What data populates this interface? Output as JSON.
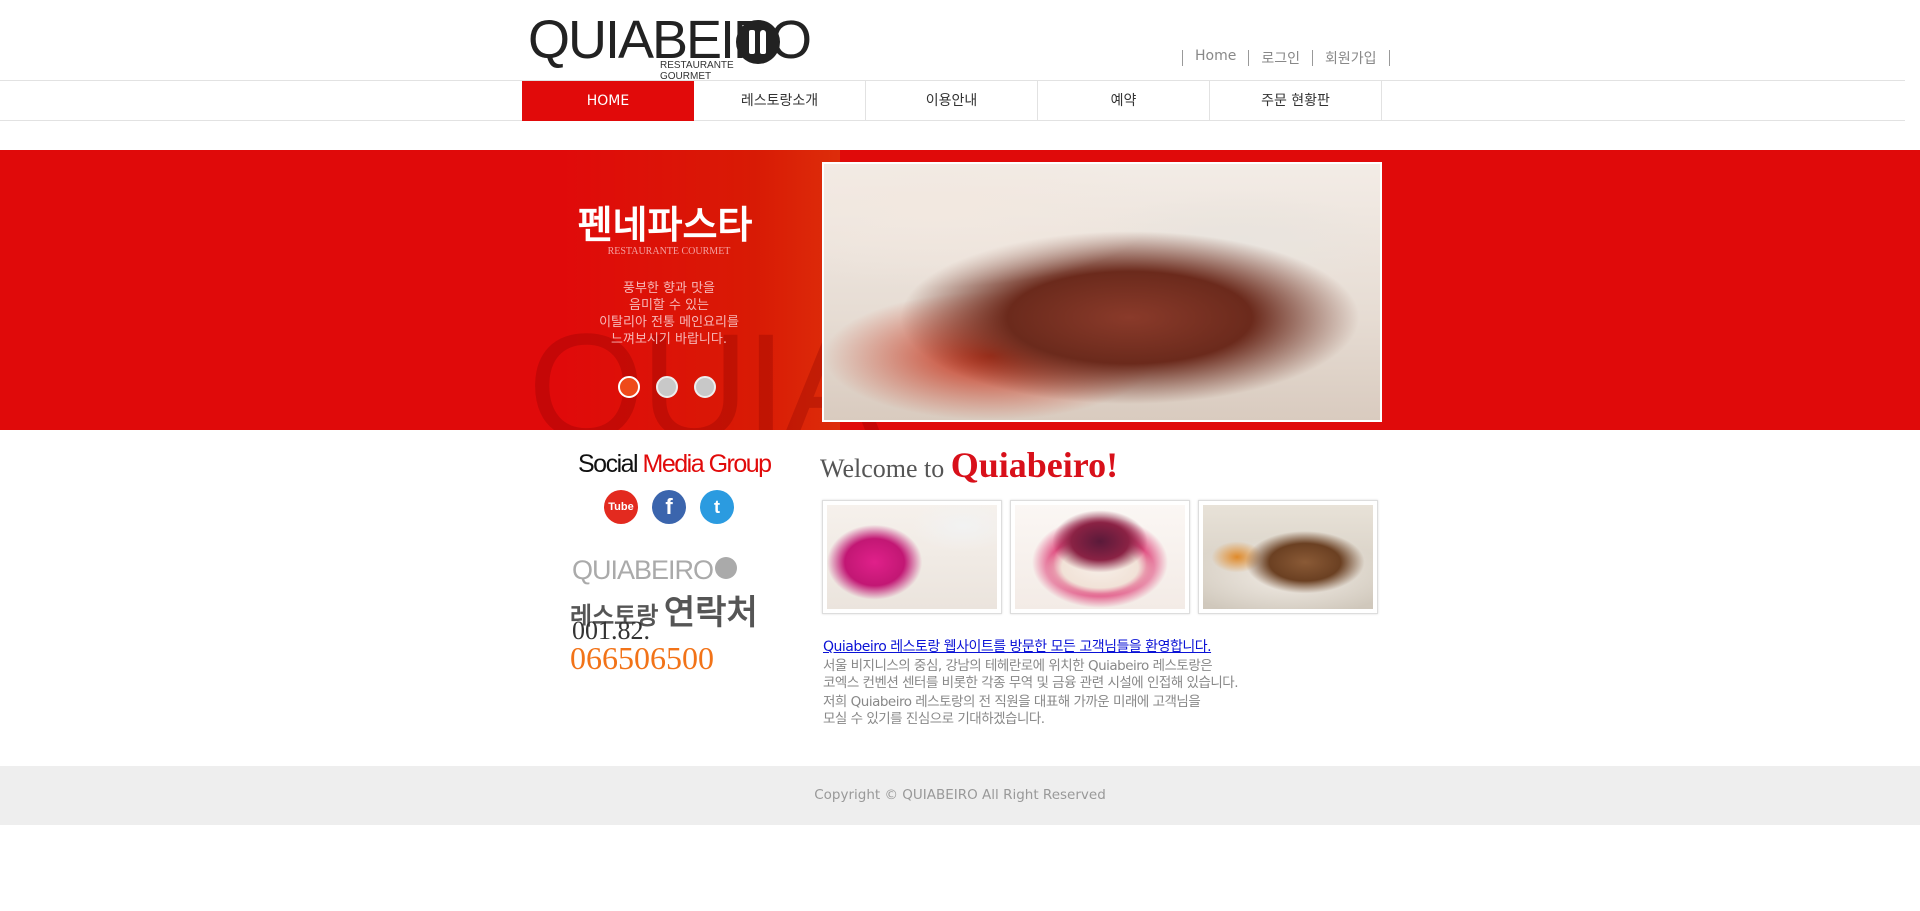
{
  "header": {
    "logo_text": "QUIABEIRO",
    "logo_sub": "RESTAURANTE GOURMET",
    "top_links": [
      "Home",
      "로그인",
      "회원가입"
    ]
  },
  "nav": {
    "items": [
      {
        "label": "HOME",
        "active": true
      },
      {
        "label": "레스토랑소개",
        "active": false
      },
      {
        "label": "이용안내",
        "active": false
      },
      {
        "label": "예약",
        "active": false
      },
      {
        "label": "주문 현황판",
        "active": false
      }
    ]
  },
  "banner": {
    "watermark": "QUIA",
    "title": "펜네파스타",
    "subtitle": "RESTAURANTE COURMET",
    "text_lines": [
      "풍부한 향과 맛을",
      "음미할 수 있는",
      "이탈리아 전통 메인요리를",
      "느껴보시기 바랍니다."
    ],
    "slides_total": 3,
    "active_slide": 1,
    "accent_color": "#e00a0a"
  },
  "social": {
    "title_black": "Social ",
    "title_red": "Media Group",
    "icons": [
      {
        "name": "youtube-icon",
        "glyph": "Tube"
      },
      {
        "name": "facebook-icon",
        "glyph": "f"
      },
      {
        "name": "twitter-icon",
        "glyph": "t"
      }
    ]
  },
  "contact": {
    "logo_text": "QUIABEIRO",
    "label_small": "레스토랑",
    "label_big": "연락처",
    "phone_prefix": "001.82.",
    "phone_number": "066506500",
    "phone_color": "#f27318"
  },
  "welcome": {
    "prefix": "Welcome to ",
    "brand": "Quiabeiro!"
  },
  "intro": {
    "link": "Quiabeiro 레스토랑 웹사이트를 방문한 모든 고객님들을 환영합니다.",
    "paragraph1_line1": "서울 비지니스의 중심, 강남의 테헤란로에 위치한 Quiabeiro 레스토랑은",
    "paragraph1_line2": "코엑스 컨벤션 센터를 비롯한 각종 무역 및 금융 관련 시설에 인접해 있습니다.",
    "paragraph2_line1": "저희 Quiabeiro 레스토랑의 전 직원을 대표해 가까운 미래에 고객님을",
    "paragraph2_line2": "모실 수 있기를 진심으로 기대하겠습니다."
  },
  "footer": {
    "copyright": "Copyright © QUIABEIRO All Right Reserved"
  }
}
